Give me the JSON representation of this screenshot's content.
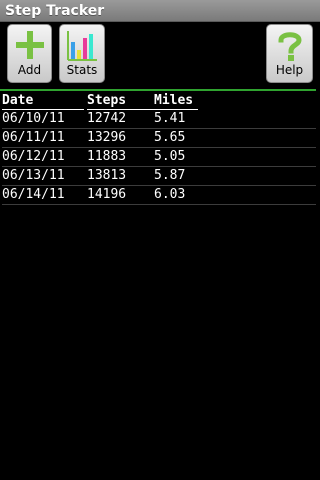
{
  "app": {
    "title": "Step Tracker"
  },
  "toolbar": {
    "add_label": "Add",
    "stats_label": "Stats",
    "help_label": "Help",
    "icons": {
      "add": "plus-icon",
      "stats": "bar-chart-icon",
      "help": "question-mark-icon"
    }
  },
  "table": {
    "headers": [
      "Date",
      "Steps",
      "Miles"
    ],
    "rows": [
      [
        "06/10/11",
        "12742",
        "5.41"
      ],
      [
        "06/11/11",
        "13296",
        "5.65"
      ],
      [
        "06/12/11",
        "11883",
        "5.05"
      ],
      [
        "06/13/11",
        "13813",
        "5.87"
      ],
      [
        "06/14/11",
        "14196",
        "6.03"
      ]
    ]
  },
  "colors": {
    "accent": "#7ac143",
    "divider": "#2fa32f",
    "background": "#000000"
  }
}
